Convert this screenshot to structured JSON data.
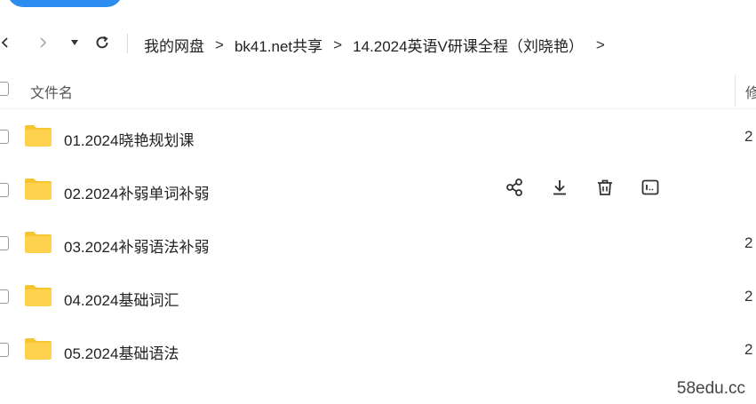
{
  "toolbar": {
    "back_icon": "chevron-left-icon",
    "forward_icon": "chevron-right-icon",
    "dropdown_icon": "caret-down-icon",
    "refresh_icon": "refresh-icon"
  },
  "breadcrumb": {
    "items": [
      "我的网盘",
      "bk41.net共享",
      "14.2024英语V研课全程（刘晓艳）"
    ],
    "separator": ">"
  },
  "table": {
    "header": {
      "name": "文件名",
      "next_col": "修"
    },
    "rows": [
      {
        "name": "01.2024晓艳规划课",
        "date": "2"
      },
      {
        "name": "02.2024补弱单词补弱",
        "date": ""
      },
      {
        "name": "03.2024补弱语法补弱",
        "date": "2"
      },
      {
        "name": "04.2024基础词汇",
        "date": "2"
      },
      {
        "name": "05.2024基础语法",
        "date": "2"
      }
    ],
    "hover_actions": [
      "share-icon",
      "download-icon",
      "delete-icon",
      "rename-icon"
    ]
  },
  "colors": {
    "accent": "#2d8cf0",
    "folder": "#ffd24d",
    "folder_tab": "#f7c531"
  },
  "watermark": "58edu.cc"
}
